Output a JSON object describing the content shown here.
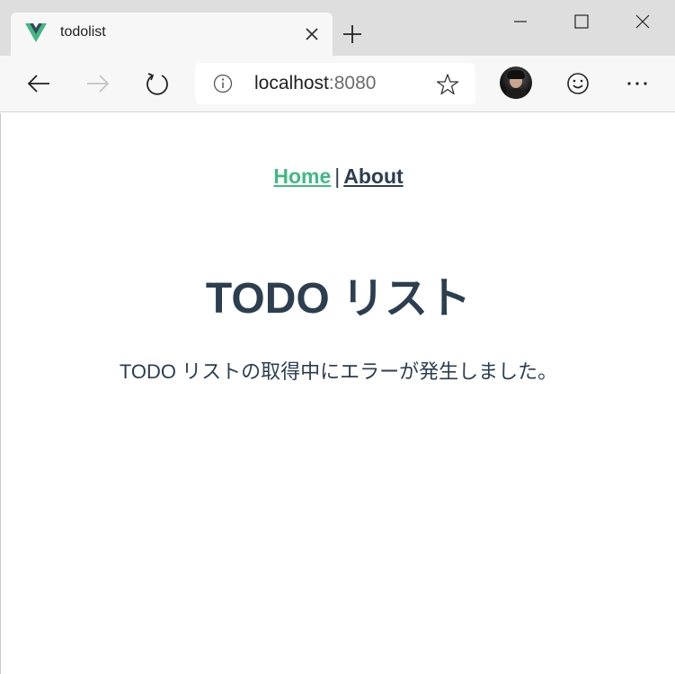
{
  "browser": {
    "tab": {
      "title": "todolist"
    },
    "address": {
      "host": "localhost",
      "port": ":8080"
    }
  },
  "nav": {
    "home_label": "Home",
    "separator": "|",
    "about_label": "About"
  },
  "main": {
    "title": "TODO リスト",
    "error_message": "TODO リストの取得中にエラーが発生しました。"
  },
  "colors": {
    "link_active": "#42b983",
    "text": "#2c3e50",
    "vue_green": "#41b883",
    "vue_dark": "#35495e"
  },
  "icons": {
    "favicon": "vue-logo-icon",
    "tab_close": "close-icon",
    "new_tab": "plus-icon",
    "minimize": "minimize-icon",
    "maximize": "maximize-icon",
    "window_close": "close-icon",
    "back": "arrow-left-icon",
    "forward": "arrow-right-icon",
    "reload": "reload-icon",
    "site_info": "info-icon",
    "favorite": "star-icon",
    "feedback": "smiley-icon",
    "more": "more-icon"
  }
}
